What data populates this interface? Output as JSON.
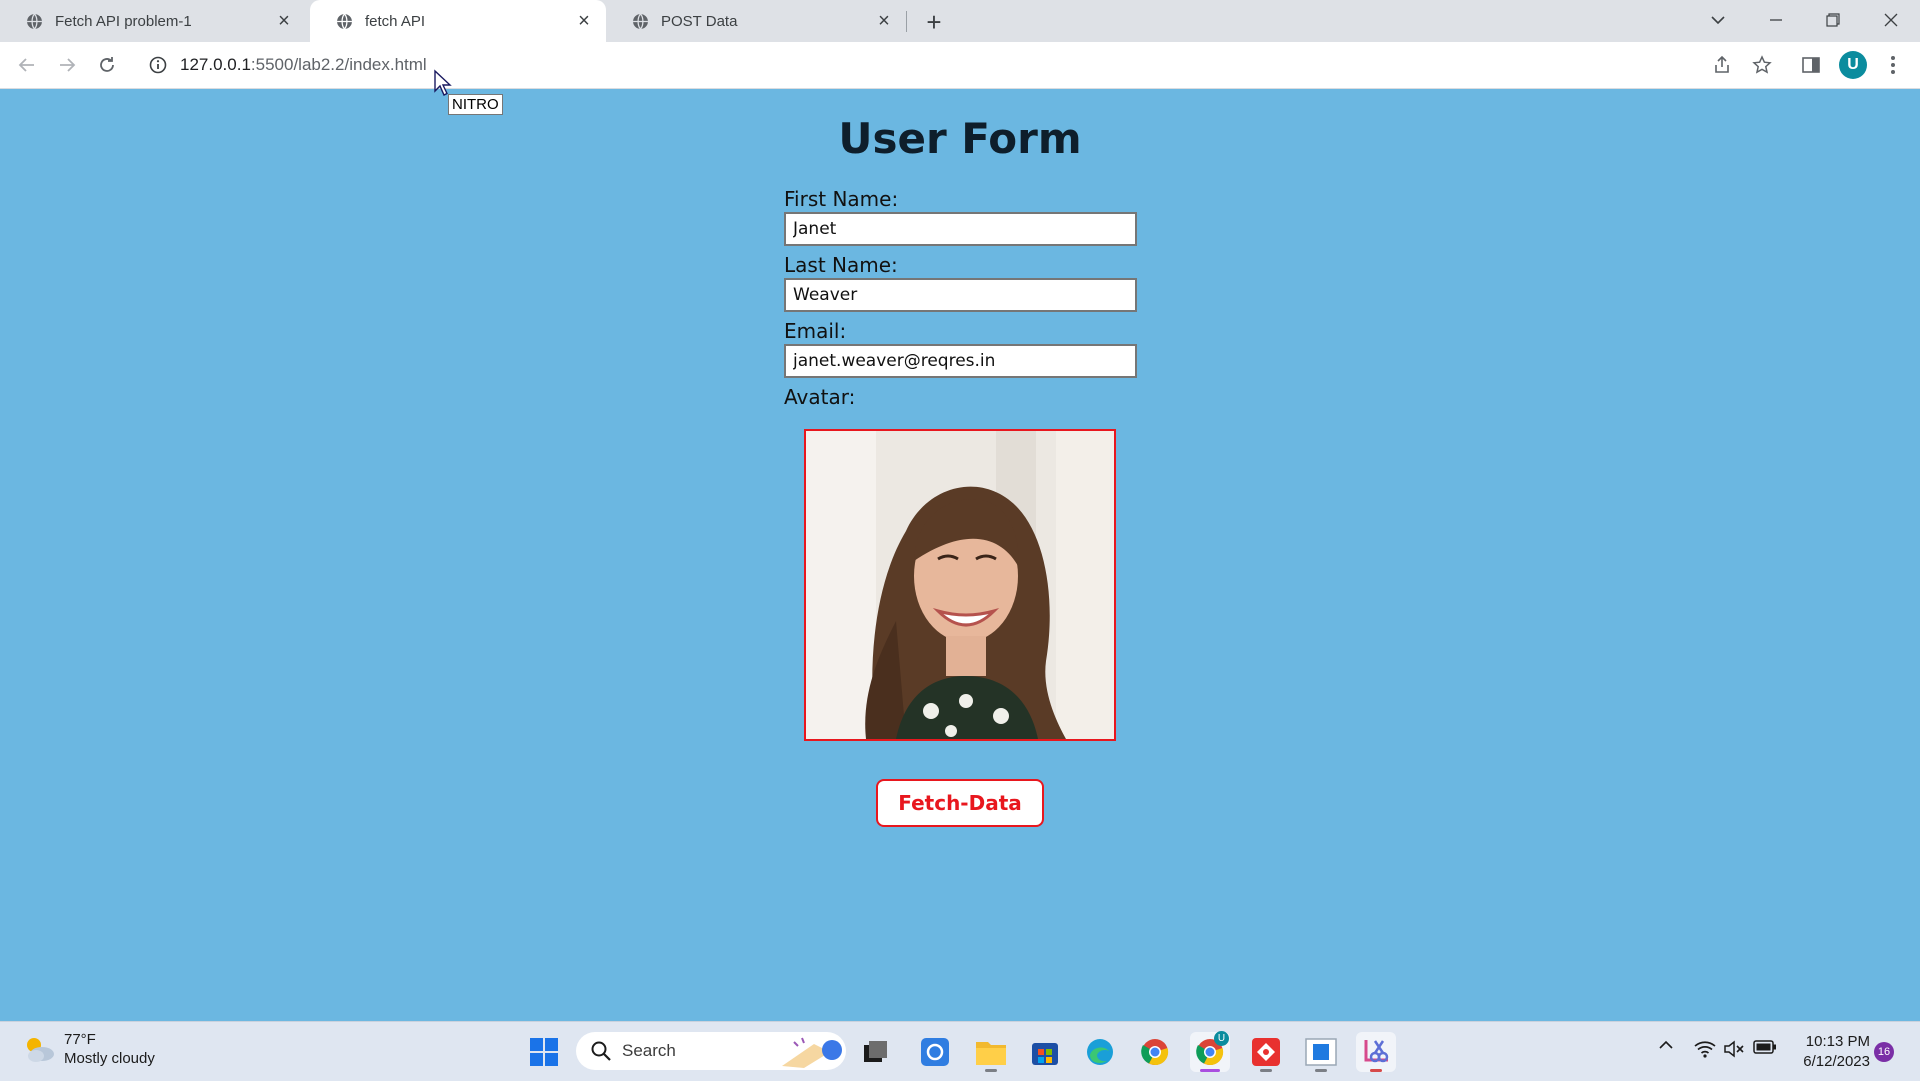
{
  "tabs": [
    {
      "label": "Fetch API problem-1",
      "active": false
    },
    {
      "label": "fetch API",
      "active": true
    },
    {
      "label": "POST Data",
      "active": false
    }
  ],
  "address_bar": {
    "host": "127.0.0.1",
    "rest": ":5500/lab2.2/index.html"
  },
  "profile_initial": "U",
  "tooltip": "NITRO",
  "page": {
    "title": "User Form",
    "first_name_label": "First Name:",
    "first_name_value": "Janet",
    "last_name_label": "Last Name:",
    "last_name_value": "Weaver",
    "email_label": "Email:",
    "email_value": "janet.weaver@reqres.in",
    "avatar_label": "Avatar:",
    "fetch_button": "Fetch-Data"
  },
  "taskbar": {
    "weather_temp": "77°F",
    "weather_desc": "Mostly cloudy",
    "search_placeholder": "Search",
    "time": "10:13 PM",
    "date": "6/12/2023",
    "notification_count": "16",
    "chrome_badge": "U"
  },
  "colors": {
    "page_background": "#6bb7e1",
    "accent_red": "#e8171e"
  }
}
